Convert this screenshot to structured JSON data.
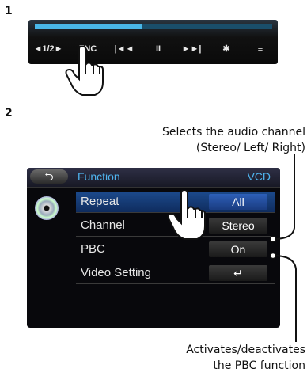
{
  "steps": [
    "1",
    "2"
  ],
  "step1": {
    "progress_fraction": 0.45,
    "buttons": [
      {
        "label": "◄1/2►"
      },
      {
        "label": "FNC"
      },
      {
        "label": "|◄◄"
      },
      {
        "label": "II"
      },
      {
        "label": "►►|"
      },
      {
        "label": "✱"
      },
      {
        "label": "≡"
      }
    ]
  },
  "step2": {
    "back_label": "⮌",
    "title": "Function",
    "source": "VCD",
    "rows": [
      {
        "label": "Repeat",
        "value": "All"
      },
      {
        "label": "Channel",
        "value": "Stereo"
      },
      {
        "label": "PBC",
        "value": "On"
      },
      {
        "label": "Video Setting",
        "value": "↵"
      }
    ],
    "callout_top": [
      "Selects the audio channel",
      "(Stereo/ Left/ Right)"
    ],
    "callout_bottom": [
      "Activates/deactivates",
      "the PBC function"
    ]
  },
  "colors": {
    "accent": "#4fb4ef",
    "progress": "#49b7e8",
    "selected_row": "#1c4a8c"
  }
}
